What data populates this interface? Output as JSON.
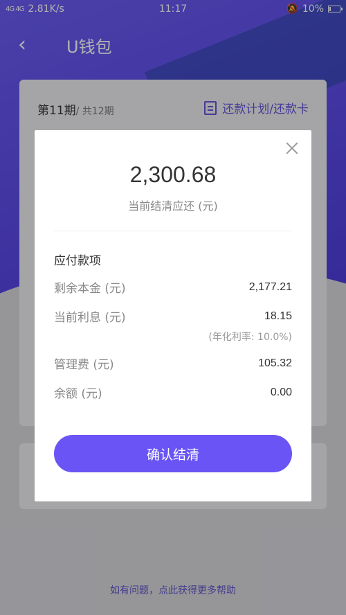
{
  "status_bar": {
    "network": "4G 4G",
    "speed": "2.81K/s",
    "time": "11:17",
    "battery": "10%",
    "icons": [
      "signal-icon",
      "bell-mute-icon",
      "battery-icon"
    ]
  },
  "nav": {
    "back_icon": "chevron-left-icon",
    "title": "U钱包"
  },
  "card": {
    "period_current": "第11期",
    "period_total": "/ 共12期",
    "plan_link_label": "还款计划/还款卡",
    "plan_icon": "document-icon"
  },
  "footer": {
    "help_text": "如有问题，点此获得更多帮助"
  },
  "dialog": {
    "close_icon": "close-icon",
    "amount": "2,300.68",
    "amount_label": "当前结清应还 (元)",
    "section_title": "应付款项",
    "items": [
      {
        "label": "剩余本金 (元)",
        "value": "2,177.21"
      },
      {
        "label": "当前利息 (元)",
        "value": "18.15"
      },
      {
        "label": "管理费 (元)",
        "value": "105.32"
      },
      {
        "label": "余额 (元)",
        "value": "0.00"
      }
    ],
    "rate_note": "(年化利率: 10.0%)",
    "confirm_label": "确认结清"
  },
  "colors": {
    "accent": "#6a54f5",
    "hero": "#5b49e6"
  }
}
